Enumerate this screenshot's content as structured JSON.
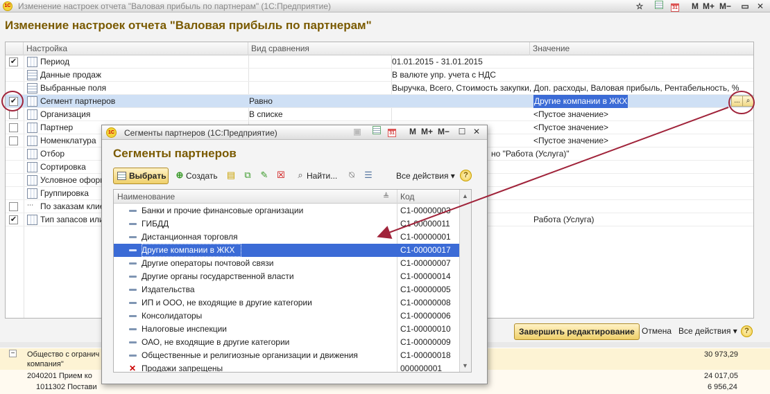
{
  "main_window": {
    "title": "Изменение настроек отчета \"Валовая прибыль по партнерам\"  (1С:Предприятие)",
    "logo_text": "1С",
    "toolbar": {
      "m": "M",
      "m_plus": "M+",
      "m_minus": "M−"
    },
    "header": "Изменение настроек отчета \"Валовая прибыль по партнерам\"",
    "grid": {
      "columns": [
        "Настройка",
        "Вид сравнения",
        "Значение"
      ],
      "rows": [
        {
          "checked": true,
          "checkbox": true,
          "label": "Период",
          "comparison": "",
          "value": "01.01.2015 - 31.01.2015",
          "value_col": "mid"
        },
        {
          "checked": false,
          "checkbox": false,
          "label": "Данные продаж",
          "comparison": "",
          "value": "В валюте упр. учета с НДС",
          "value_col": "mid"
        },
        {
          "checked": false,
          "checkbox": false,
          "label": "Выбранные поля",
          "comparison": "",
          "value": "Выручка, Всего, Стоимость закупки, Доп. расходы, Валовая прибыль, Рентабельность, %",
          "value_col": "mid"
        },
        {
          "checked": true,
          "checkbox": true,
          "label": "Сегмент партнеров",
          "comparison": "Равно",
          "value": "Другие компании в ЖКХ",
          "value_col": "right",
          "selected": true
        },
        {
          "checked": false,
          "checkbox": true,
          "label": "Организация",
          "comparison": "В списке",
          "value": "<Пустое значение>",
          "value_col": "right"
        },
        {
          "checked": false,
          "checkbox": true,
          "label": "Партнер",
          "comparison": "",
          "value": "<Пустое значение>",
          "value_col": "right"
        },
        {
          "checked": false,
          "checkbox": true,
          "label": "Номенклатура",
          "comparison": "",
          "value": "<Пустое значение>",
          "value_col": "right"
        },
        {
          "checked": false,
          "checkbox": false,
          "label": "Отбор",
          "comparison": "",
          "value": "но \"Работа (Услуга)\"",
          "value_col": "obscured"
        },
        {
          "checked": false,
          "checkbox": false,
          "label": "Сортировка",
          "comparison": "",
          "value": "",
          "value_col": "mid"
        },
        {
          "checked": false,
          "checkbox": false,
          "label": "Условное оформ",
          "comparison": "",
          "value": "",
          "value_col": "mid"
        },
        {
          "checked": false,
          "checkbox": false,
          "label": "Группировка",
          "comparison": "",
          "value": "",
          "value_col": "mid"
        },
        {
          "checked": false,
          "checkbox": true,
          "label": "По заказам клие",
          "comparison": "",
          "value": "",
          "value_col": "mid"
        },
        {
          "checked": true,
          "checkbox": true,
          "label": "Тип запасов или",
          "comparison": "",
          "value": "Работа (Услуга)",
          "value_col": "right"
        }
      ],
      "choice_button": "...",
      "search_icon": "magnifier-icon"
    },
    "finish_button": "Завершить редактирование",
    "cancel_link": "Отмена",
    "all_actions": "Все действия ▾",
    "help": "?"
  },
  "background_report": {
    "rows": [
      {
        "col1": "",
        "col2": "",
        "num": ""
      },
      {
        "col1": "Общество с огранич",
        "col2": "компания\"",
        "num": "30 973,29"
      },
      {
        "col1": "2040201 Прием ко",
        "col2": "",
        "num": "24 017,05"
      },
      {
        "col1": "1011302 Постави",
        "col2": "",
        "num": "6 956,24"
      }
    ]
  },
  "dialog": {
    "title": "Сегменты партнеров  (1С:Предприятие)",
    "logo_text": "1С",
    "toolbar": {
      "m": "M",
      "m_plus": "M+",
      "m_minus": "M−",
      "close": "✕",
      "restore": "☐"
    },
    "header": "Сегменты партнеров",
    "buttons": {
      "select": "Выбрать",
      "create": "Создать",
      "find": "Найти...",
      "all_actions": "Все действия ▾",
      "help": "?"
    },
    "columns": [
      "Наименование",
      "Код"
    ],
    "rows": [
      {
        "name": "Банки и прочие финансовые организации",
        "code": "С1-00000003"
      },
      {
        "name": "ГИБДД",
        "code": "С1-00000011"
      },
      {
        "name": "Дистанционная торговля",
        "code": "С1-00000001"
      },
      {
        "name": "Другие компании в ЖКХ",
        "code": "С1-00000017",
        "selected": true
      },
      {
        "name": "Другие операторы почтовой связи",
        "code": "С1-00000007"
      },
      {
        "name": "Другие органы государственной власти",
        "code": "С1-00000014"
      },
      {
        "name": "Издательства",
        "code": "С1-00000005"
      },
      {
        "name": "ИП и ООО, не входящие в другие категории",
        "code": "С1-00000008"
      },
      {
        "name": "Консолидаторы",
        "code": "С1-00000006"
      },
      {
        "name": "Налоговые инспекции",
        "code": "С1-00000010"
      },
      {
        "name": "ОАО, не входящие в другие категории",
        "code": "С1-00000009"
      },
      {
        "name": "Общественные и религиозные организации и движения",
        "code": "С1-00000018"
      },
      {
        "name": "Продажи запрещены",
        "code": "000000001",
        "deleted": true
      }
    ]
  },
  "annotation_color": "#a0233a"
}
